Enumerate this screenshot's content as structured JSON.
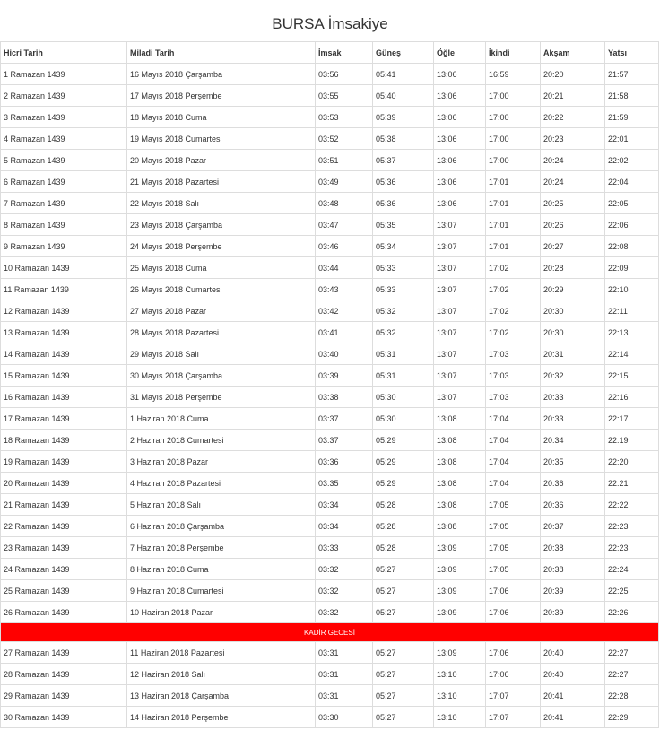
{
  "title": "BURSA İmsakiye",
  "columns": [
    "Hicri Tarih",
    "Miladi Tarih",
    "İmsak",
    "Güneş",
    "Öğle",
    "İkindi",
    "Akşam",
    "Yatsı"
  ],
  "rows_a": [
    [
      "1 Ramazan 1439",
      "16 Mayıs 2018 Çarşamba",
      "03:56",
      "05:41",
      "13:06",
      "16:59",
      "20:20",
      "21:57"
    ],
    [
      "2 Ramazan 1439",
      "17 Mayıs 2018 Perşembe",
      "03:55",
      "05:40",
      "13:06",
      "17:00",
      "20:21",
      "21:58"
    ],
    [
      "3 Ramazan 1439",
      "18 Mayıs 2018 Cuma",
      "03:53",
      "05:39",
      "13:06",
      "17:00",
      "20:22",
      "21:59"
    ],
    [
      "4 Ramazan 1439",
      "19 Mayıs 2018 Cumartesi",
      "03:52",
      "05:38",
      "13:06",
      "17:00",
      "20:23",
      "22:01"
    ],
    [
      "5 Ramazan 1439",
      "20 Mayıs 2018 Pazar",
      "03:51",
      "05:37",
      "13:06",
      "17:00",
      "20:24",
      "22:02"
    ],
    [
      "6 Ramazan 1439",
      "21 Mayıs 2018 Pazartesi",
      "03:49",
      "05:36",
      "13:06",
      "17:01",
      "20:24",
      "22:04"
    ],
    [
      "7 Ramazan 1439",
      "22 Mayıs 2018 Salı",
      "03:48",
      "05:36",
      "13:06",
      "17:01",
      "20:25",
      "22:05"
    ],
    [
      "8 Ramazan 1439",
      "23 Mayıs 2018 Çarşamba",
      "03:47",
      "05:35",
      "13:07",
      "17:01",
      "20:26",
      "22:06"
    ],
    [
      "9 Ramazan 1439",
      "24 Mayıs 2018 Perşembe",
      "03:46",
      "05:34",
      "13:07",
      "17:01",
      "20:27",
      "22:08"
    ],
    [
      "10 Ramazan 1439",
      "25 Mayıs 2018 Cuma",
      "03:44",
      "05:33",
      "13:07",
      "17:02",
      "20:28",
      "22:09"
    ],
    [
      "11 Ramazan 1439",
      "26 Mayıs 2018 Cumartesi",
      "03:43",
      "05:33",
      "13:07",
      "17:02",
      "20:29",
      "22:10"
    ],
    [
      "12 Ramazan 1439",
      "27 Mayıs 2018 Pazar",
      "03:42",
      "05:32",
      "13:07",
      "17:02",
      "20:30",
      "22:11"
    ],
    [
      "13 Ramazan 1439",
      "28 Mayıs 2018 Pazartesi",
      "03:41",
      "05:32",
      "13:07",
      "17:02",
      "20:30",
      "22:13"
    ],
    [
      "14 Ramazan 1439",
      "29 Mayıs 2018 Salı",
      "03:40",
      "05:31",
      "13:07",
      "17:03",
      "20:31",
      "22:14"
    ],
    [
      "15 Ramazan 1439",
      "30 Mayıs 2018 Çarşamba",
      "03:39",
      "05:31",
      "13:07",
      "17:03",
      "20:32",
      "22:15"
    ],
    [
      "16 Ramazan 1439",
      "31 Mayıs 2018 Perşembe",
      "03:38",
      "05:30",
      "13:07",
      "17:03",
      "20:33",
      "22:16"
    ],
    [
      "17 Ramazan 1439",
      "1 Haziran 2018 Cuma",
      "03:37",
      "05:30",
      "13:08",
      "17:04",
      "20:33",
      "22:17"
    ],
    [
      "18 Ramazan 1439",
      "2 Haziran 2018 Cumartesi",
      "03:37",
      "05:29",
      "13:08",
      "17:04",
      "20:34",
      "22:19"
    ],
    [
      "19 Ramazan 1439",
      "3 Haziran 2018 Pazar",
      "03:36",
      "05:29",
      "13:08",
      "17:04",
      "20:35",
      "22:20"
    ],
    [
      "20 Ramazan 1439",
      "4 Haziran 2018 Pazartesi",
      "03:35",
      "05:29",
      "13:08",
      "17:04",
      "20:36",
      "22:21"
    ],
    [
      "21 Ramazan 1439",
      "5 Haziran 2018 Salı",
      "03:34",
      "05:28",
      "13:08",
      "17:05",
      "20:36",
      "22:22"
    ],
    [
      "22 Ramazan 1439",
      "6 Haziran 2018 Çarşamba",
      "03:34",
      "05:28",
      "13:08",
      "17:05",
      "20:37",
      "22:23"
    ],
    [
      "23 Ramazan 1439",
      "7 Haziran 2018 Perşembe",
      "03:33",
      "05:28",
      "13:09",
      "17:05",
      "20:38",
      "22:23"
    ],
    [
      "24 Ramazan 1439",
      "8 Haziran 2018 Cuma",
      "03:32",
      "05:27",
      "13:09",
      "17:05",
      "20:38",
      "22:24"
    ],
    [
      "25 Ramazan 1439",
      "9 Haziran 2018 Cumartesi",
      "03:32",
      "05:27",
      "13:09",
      "17:06",
      "20:39",
      "22:25"
    ],
    [
      "26 Ramazan 1439",
      "10 Haziran 2018 Pazar",
      "03:32",
      "05:27",
      "13:09",
      "17:06",
      "20:39",
      "22:26"
    ]
  ],
  "special_row": {
    "label": "KADİR GECESİ",
    "color": "#ff0000"
  },
  "rows_b": [
    [
      "27 Ramazan 1439",
      "11 Haziran 2018 Pazartesi",
      "03:31",
      "05:27",
      "13:09",
      "17:06",
      "20:40",
      "22:27"
    ],
    [
      "28 Ramazan 1439",
      "12 Haziran 2018 Salı",
      "03:31",
      "05:27",
      "13:10",
      "17:06",
      "20:40",
      "22:27"
    ],
    [
      "29 Ramazan 1439",
      "13 Haziran 2018 Çarşamba",
      "03:31",
      "05:27",
      "13:10",
      "17:07",
      "20:41",
      "22:28"
    ],
    [
      "30 Ramazan 1439",
      "14 Haziran 2018 Perşembe",
      "03:30",
      "05:27",
      "13:10",
      "17:07",
      "20:41",
      "22:29"
    ]
  ]
}
